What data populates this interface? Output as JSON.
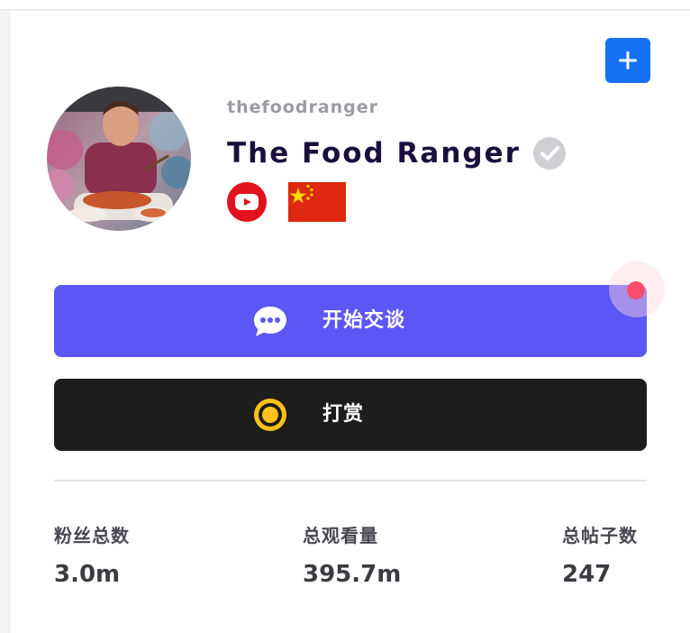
{
  "profile": {
    "handle": "thefoodranger",
    "display_name": "The Food Ranger",
    "verified_icon": "check-circle-icon",
    "platform_icon": "youtube-icon",
    "country_icon": "china-flag-icon"
  },
  "header": {
    "add_icon": "plus-icon"
  },
  "actions": {
    "chat": {
      "label": "开始交谈",
      "icon": "chat-bubble-icon"
    },
    "tip": {
      "label": "打赏",
      "icon": "coin-icon"
    }
  },
  "stats": [
    {
      "label": "粉丝总数",
      "value": "3.0m"
    },
    {
      "label": "总观看量",
      "value": "395.7m"
    },
    {
      "label": "总帖子数",
      "value": "247"
    }
  ],
  "colors": {
    "accent": "#5b57f6",
    "add_button": "#1572f5",
    "tip_button": "#1d1d1b",
    "notify": "#ff4d6d",
    "youtube": "#e0121b",
    "flag_red": "#de2910",
    "flag_star": "#ffde00"
  }
}
